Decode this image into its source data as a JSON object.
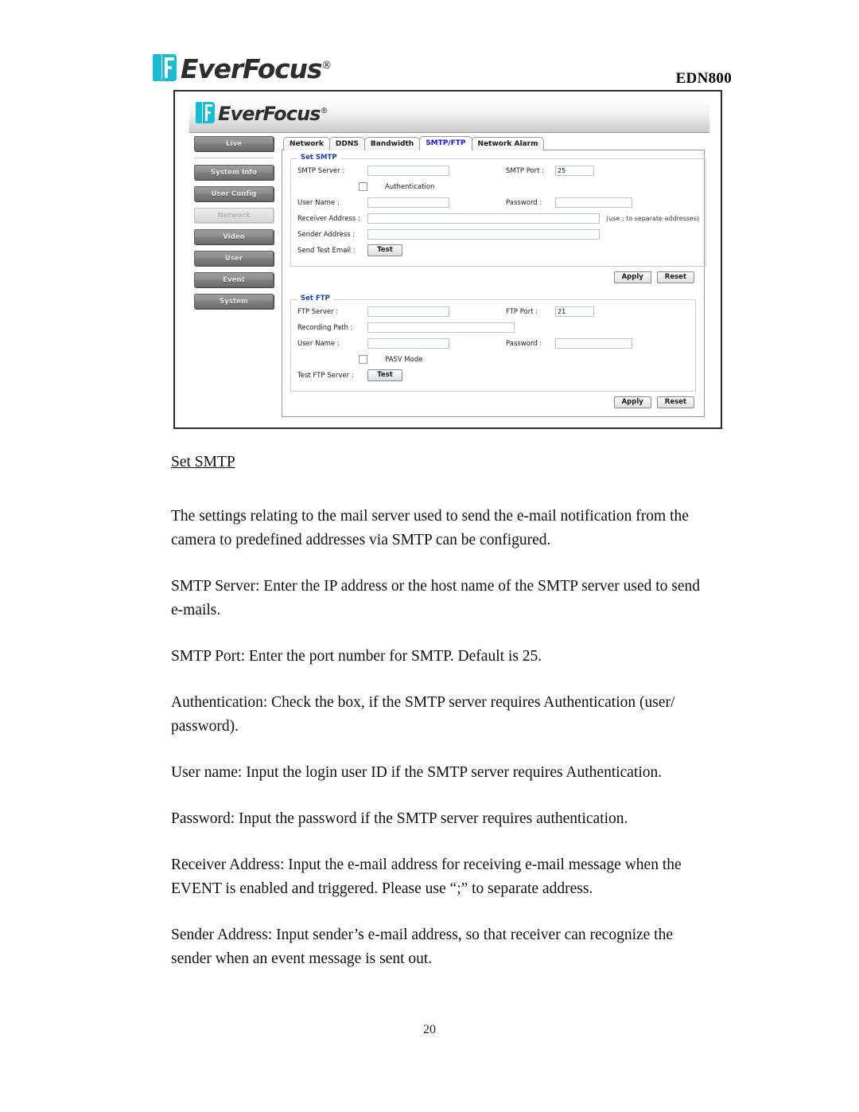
{
  "header": {
    "brand": "EverFocus",
    "registered": "®",
    "model": "EDN800"
  },
  "screenshot": {
    "app_brand": "EverFocus",
    "app_registered": "®",
    "nav": {
      "items": [
        {
          "label": "Live",
          "active": false
        },
        {
          "label": "System Info",
          "active": false
        },
        {
          "label": "User Config",
          "active": false
        },
        {
          "label": "Network",
          "active": true
        },
        {
          "label": "Video",
          "active": false
        },
        {
          "label": "User",
          "active": false
        },
        {
          "label": "Event",
          "active": false
        },
        {
          "label": "System",
          "active": false
        }
      ]
    },
    "tabs": [
      {
        "label": "Network",
        "active": false
      },
      {
        "label": "DDNS",
        "active": false
      },
      {
        "label": "Bandwidth",
        "active": false
      },
      {
        "label": "SMTP/FTP",
        "active": true
      },
      {
        "label": "Network Alarm",
        "active": false
      }
    ],
    "smtp": {
      "legend": "Set SMTP",
      "server_label": "SMTP Server :",
      "server_value": "",
      "port_label": "SMTP Port :",
      "port_value": "25",
      "auth_label": "Authentication",
      "username_label": "User Name :",
      "username_value": "",
      "password_label": "Password :",
      "password_value": "",
      "receiver_label": "Receiver Address :",
      "receiver_value": "",
      "receiver_hint": "(use ; to separate addresses)",
      "sender_label": "Sender Address :",
      "sender_value": "",
      "test_email_label": "Send Test Email :",
      "test_button": "Test",
      "apply_button": "Apply",
      "reset_button": "Reset"
    },
    "ftp": {
      "legend": "Set FTP",
      "server_label": "FTP Server :",
      "server_value": "",
      "port_label": "FTP Port :",
      "port_value": "21",
      "path_label": "Recording Path :",
      "path_value": "",
      "username_label": "User Name :",
      "username_value": "",
      "password_label": "Password :",
      "password_value": "",
      "pasv_label": "PASV Mode",
      "test_server_label": "Test FTP Server :",
      "test_button": "Test",
      "apply_button": "Apply",
      "reset_button": "Reset"
    }
  },
  "document": {
    "heading": "Set SMTP",
    "paragraphs": [
      "The settings relating to the mail server used to send the e-mail notification from the camera to predefined addresses via SMTP can be configured.",
      "SMTP Server: Enter the IP address or the host name of the SMTP server used to send e-mails.",
      "SMTP Port: Enter the port number for SMTP. Default is 25.",
      "Authentication: Check the box, if the SMTP server requires Authentication (user/ password).",
      "User name: Input the login user ID if the SMTP server requires Authentication.",
      "Password: Input the password if the SMTP server requires authentication.",
      "Receiver Address: Input the e-mail address for receiving e-mail message when the EVENT is enabled and triggered. Please use “;” to separate address.",
      "Sender Address: Input sender’s e-mail address, so that receiver can recognize the sender when an event message is sent out."
    ],
    "page_number": "20"
  },
  "colors": {
    "brand_cyan": "#19bcd4",
    "active_tab_text": "#1414e0",
    "legend_text": "#1f3fb5"
  }
}
